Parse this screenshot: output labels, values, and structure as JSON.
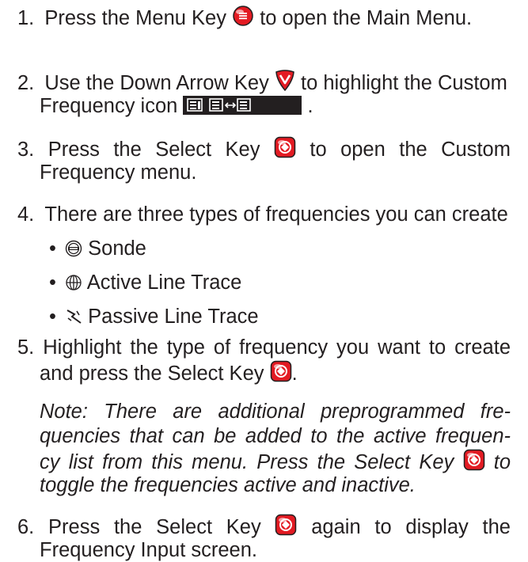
{
  "steps": {
    "s1": {
      "num": "1.",
      "a": "Press the Menu Key",
      "b": "to open the Main Menu."
    },
    "s2": {
      "num": "2.",
      "a": "Use the Down Arrow Key",
      "b": "to highlight the Custom",
      "c": "Frequency icon",
      "d": "."
    },
    "s3": {
      "num": "3.",
      "a": "Press the Select Key",
      "b": "to open the Custom",
      "c": "Frequency menu."
    },
    "s4": {
      "num": "4.",
      "a": "There are three types of frequencies you can create",
      "bullets": [
        "Sonde",
        "Active Line Trace",
        "Passive Line Trace"
      ]
    },
    "s5": {
      "num": "5.",
      "a": "Highlight the type of frequency you want to create",
      "b": "and press the Select Key",
      "c": "."
    },
    "note": {
      "l1": "Note: There are additional preprogrammed fre-",
      "l2": "quencies that can be added to the active frequen-",
      "l3": "cy list from this menu. Press the Select Key",
      "l3b": "to",
      "l4": "toggle the frequencies active and inactive."
    },
    "s6": {
      "num": "6.",
      "a": "Press the Select Key",
      "b": "again to display the",
      "c": "Frequency Input screen."
    }
  },
  "bullet_glyph": "•",
  "icons": {
    "menu_key": "menu-key-icon",
    "down_arrow_key": "down-arrow-key-icon",
    "select_key": "select-key-icon",
    "custom_frequency": "custom-frequency-icon",
    "sonde": "sonde-icon",
    "active_line_trace": "active-line-trace-icon",
    "passive_line_trace": "passive-line-trace-icon"
  },
  "colors": {
    "text": "#231f20",
    "key_red": "#e31b23",
    "icon_dark": "#231f20"
  }
}
